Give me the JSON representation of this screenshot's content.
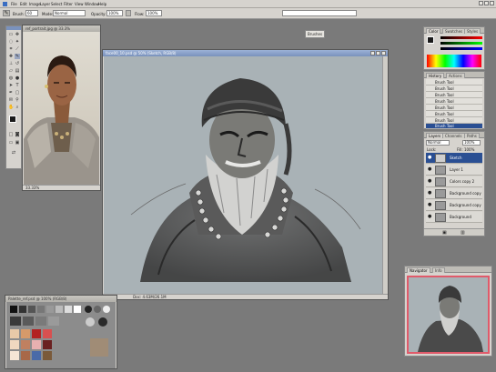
{
  "menu": [
    "File",
    "Edit",
    "Image",
    "Layer",
    "Select",
    "Filter",
    "View",
    "Window",
    "Help"
  ],
  "options": {
    "brush_label": "Brush:",
    "brush_size": "60",
    "mode_label": "Mode:",
    "mode_value": "Normal",
    "opacity_label": "Opacity:",
    "opacity_value": "100%",
    "flow_label": "Flow:",
    "flow_value": "100%"
  },
  "search_placeholder": "",
  "brushes_well": "Brushes",
  "ref_window": {
    "title": "ref_portrait.jpg @ 33.3%",
    "status": "33.33%"
  },
  "main_window": {
    "title": "face00_10.psd @ 50% (Sketch, RGB/8)",
    "status_zoom": "50%",
    "status_doc": "Doc: 4.63M/26.1M"
  },
  "swatch_window": {
    "title": "Palette_ref.psd @ 100% (RGB/8)"
  },
  "color_panel": {
    "tabs": [
      "Color",
      "Swatches",
      "Styles"
    ]
  },
  "history_panel": {
    "tabs": [
      "History",
      "Actions"
    ],
    "items": [
      "Brush Tool",
      "Brush Tool",
      "Brush Tool",
      "Brush Tool",
      "Brush Tool",
      "Brush Tool",
      "Brush Tool",
      "Brush Tool"
    ],
    "selected_index": 7
  },
  "layers_panel": {
    "tabs": [
      "Layers",
      "Channels",
      "Paths"
    ],
    "blend_mode": "Normal",
    "opacity": "100%",
    "lock_label": "Lock:",
    "fill_label": "Fill: 100%",
    "layers": [
      "Sketch",
      "Layer 1",
      "Colors copy 2",
      "Background copy 2",
      "Background copy",
      "Background"
    ],
    "selected_index": 0
  },
  "navigator_panel": {
    "tabs": [
      "Navigator",
      "Info"
    ]
  },
  "colors": {
    "accent": "#2a4f93",
    "canvas": "#a9b2b6",
    "foreground": "#1a1a1a",
    "background": "#b22222",
    "navigator_border": "#e05a6a"
  }
}
